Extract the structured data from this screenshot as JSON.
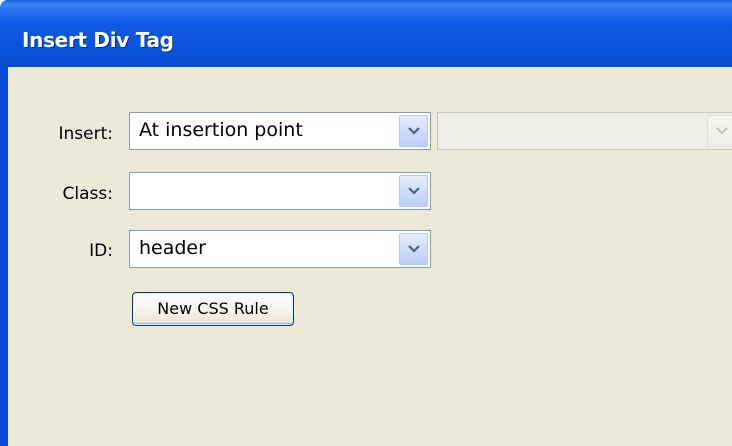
{
  "dialog": {
    "title": "Insert Div Tag"
  },
  "form": {
    "insert": {
      "label": "Insert:",
      "value": "At insertion point",
      "secondary_value": ""
    },
    "class": {
      "label": "Class:",
      "value": ""
    },
    "id": {
      "label": "ID:",
      "value": "header"
    },
    "new_css_rule_label": "New CSS Rule"
  },
  "icons": {
    "dropdown": "chevron-down-icon"
  },
  "colors": {
    "title_bar": "#0a51d9",
    "client_bg": "#ece9d8",
    "combo_border": "#7f9db9",
    "button_border": "#003c74"
  }
}
